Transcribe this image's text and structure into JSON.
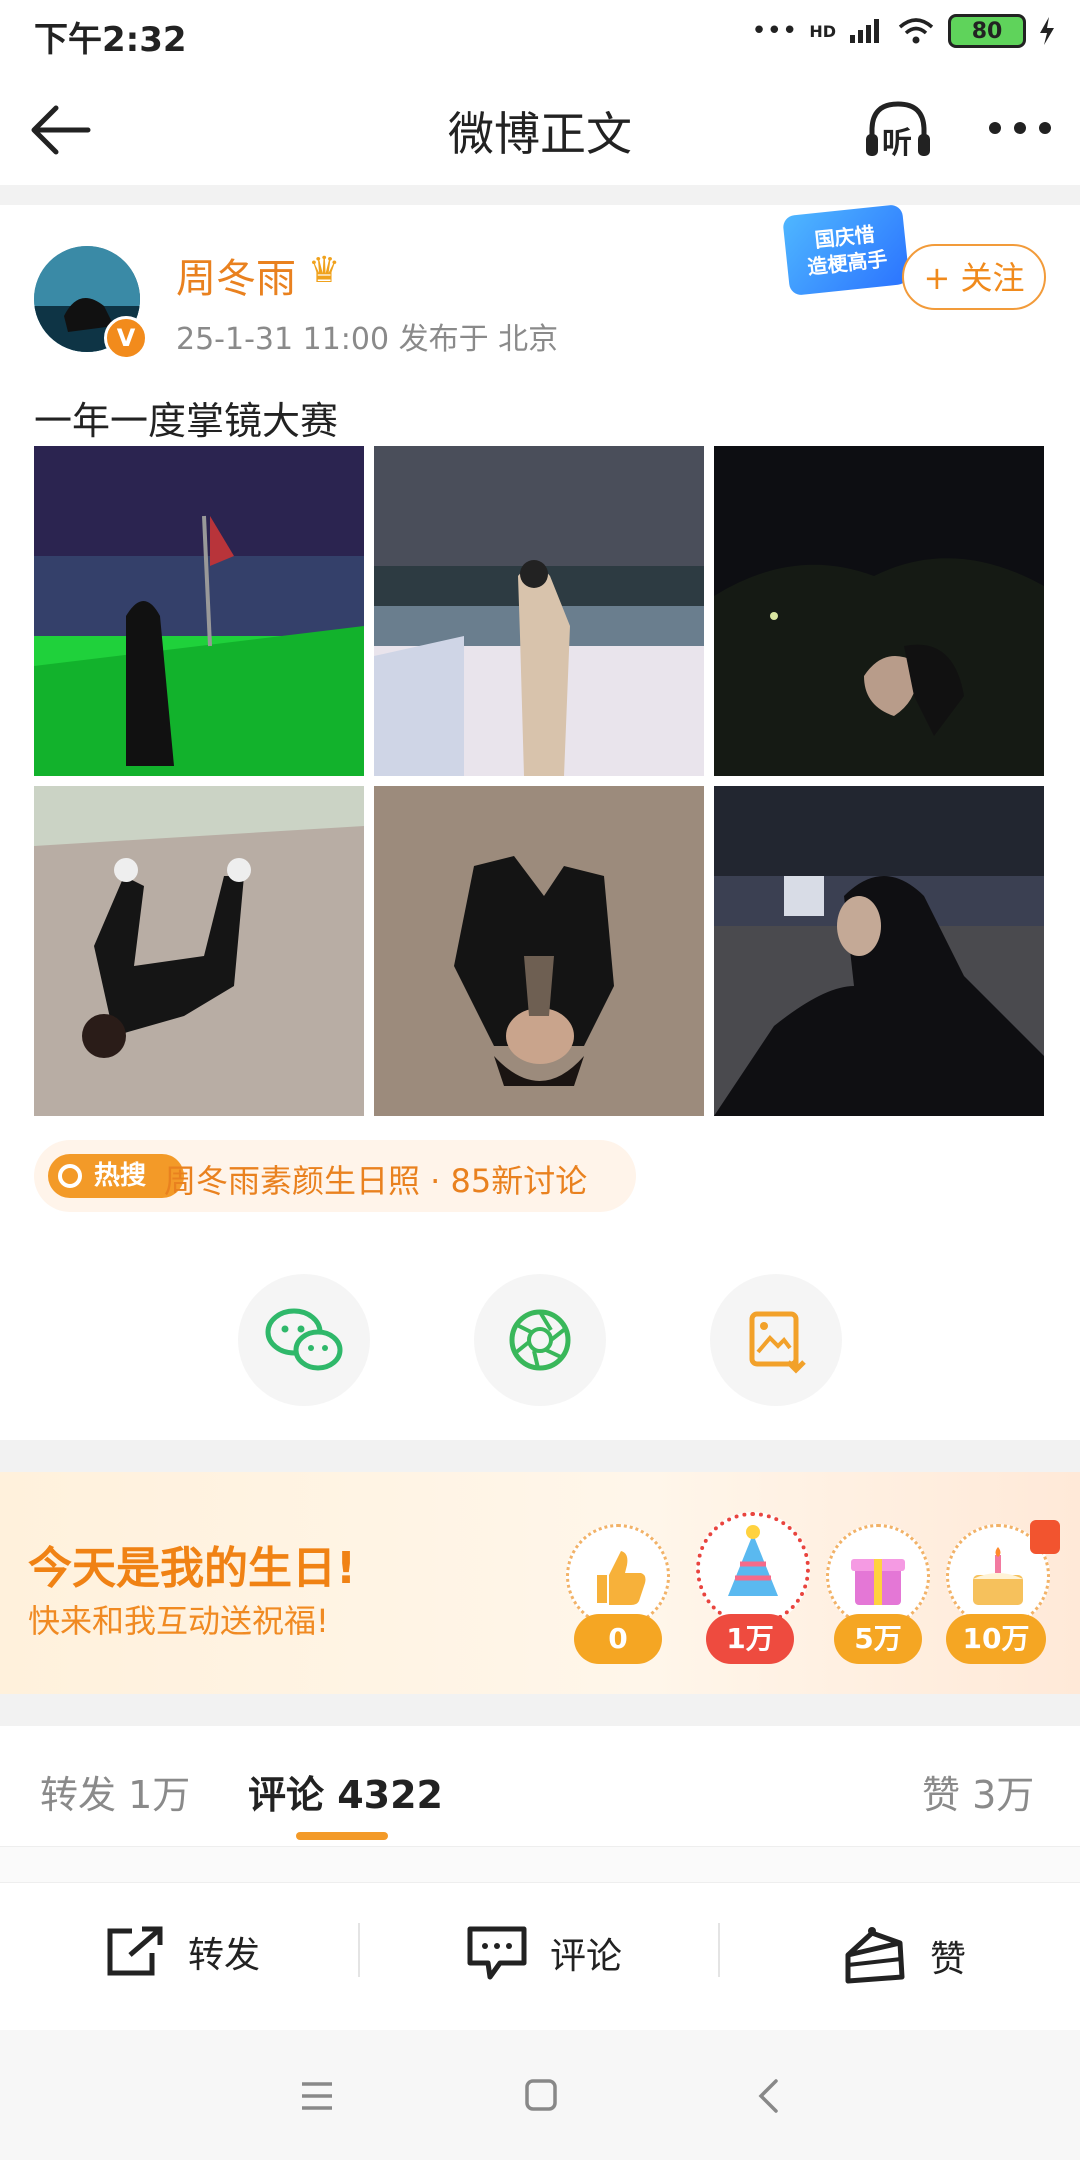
{
  "status_bar": {
    "time": "下午2:32",
    "network": "HD",
    "battery": "80"
  },
  "nav": {
    "title": "微博正文",
    "listen_label": "听"
  },
  "post": {
    "username": "周冬雨",
    "meta": "25-1-31 11:00  发布于 北京",
    "text": "一年一度掌镜大赛",
    "promo_badge": "国庆惜\n造梗高手",
    "follow_label": "+ 关注",
    "photo_count": 6
  },
  "hot_search": {
    "tag": "热搜",
    "text": "周冬雨素颜生日照 · 85新讨论"
  },
  "share": {
    "wechat": "wechat-icon",
    "moments": "moments-icon",
    "save": "save-image-icon"
  },
  "birthday": {
    "title": "今天是我的生日!",
    "subtitle": "快来和我互动送祝福!",
    "milestones": [
      "0",
      "1万",
      "5万",
      "10万"
    ]
  },
  "tabs": {
    "repost": "转发 1万",
    "comment": "评论 4322",
    "like": "赞 3万"
  },
  "actions": {
    "repost": "转发",
    "comment": "评论",
    "like": "赞"
  },
  "colors": {
    "accent": "#f08a1c",
    "link": "#e9811f"
  }
}
